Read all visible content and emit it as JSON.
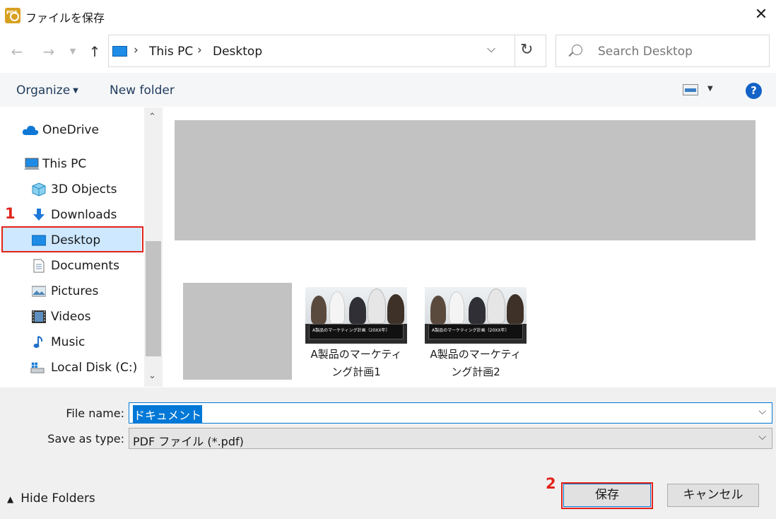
{
  "window": {
    "title": "ファイルを保存",
    "app_icon_text": "PDF",
    "close_icon": "close-icon"
  },
  "nav": {
    "back_icon": "arrow-left-icon",
    "forward_icon": "arrow-right-icon",
    "recent_icon": "chevron-down-icon",
    "up_icon": "arrow-up-icon",
    "breadcrumb": [
      "This PC",
      "Desktop"
    ],
    "refresh_icon": "refresh-icon",
    "search_placeholder": "Search Desktop"
  },
  "toolbar": {
    "organize": "Organize",
    "new_folder": "New folder",
    "help": "?"
  },
  "sidebar": {
    "items": [
      {
        "label": "OneDrive",
        "icon": "cloud-icon"
      },
      {
        "label": "This PC",
        "icon": "computer-icon"
      },
      {
        "label": "3D Objects",
        "icon": "cube-icon"
      },
      {
        "label": "Downloads",
        "icon": "download-arrow-icon"
      },
      {
        "label": "Desktop",
        "icon": "desktop-icon",
        "selected": true
      },
      {
        "label": "Documents",
        "icon": "document-icon"
      },
      {
        "label": "Pictures",
        "icon": "picture-icon"
      },
      {
        "label": "Videos",
        "icon": "film-icon"
      },
      {
        "label": "Music",
        "icon": "music-note-icon"
      },
      {
        "label": "Local Disk (C:)",
        "icon": "drive-icon"
      }
    ]
  },
  "content": {
    "files": [
      {
        "name_line1": "A製品のマーケティ",
        "name_line2": "ング計画1",
        "thumb_caption": "A製品のマーケティング計画（20XX年）"
      },
      {
        "name_line1": "A製品のマーケティ",
        "name_line2": "ング計画2",
        "thumb_caption": "A製品のマーケティング計画（20XX年）"
      }
    ]
  },
  "form": {
    "file_name_label": "File name:",
    "file_name_value": "ドキュメント",
    "save_type_label": "Save as type:",
    "save_type_value": "PDF ファイル (*.pdf)"
  },
  "footer": {
    "hide_folders": "Hide Folders",
    "save": "保存",
    "cancel": "キャンセル"
  },
  "annotations": {
    "step1": "1",
    "step2": "2",
    "highlight_color": "#e2231a"
  },
  "colors": {
    "accent": "#0078d7",
    "selection": "#cde8ff"
  }
}
